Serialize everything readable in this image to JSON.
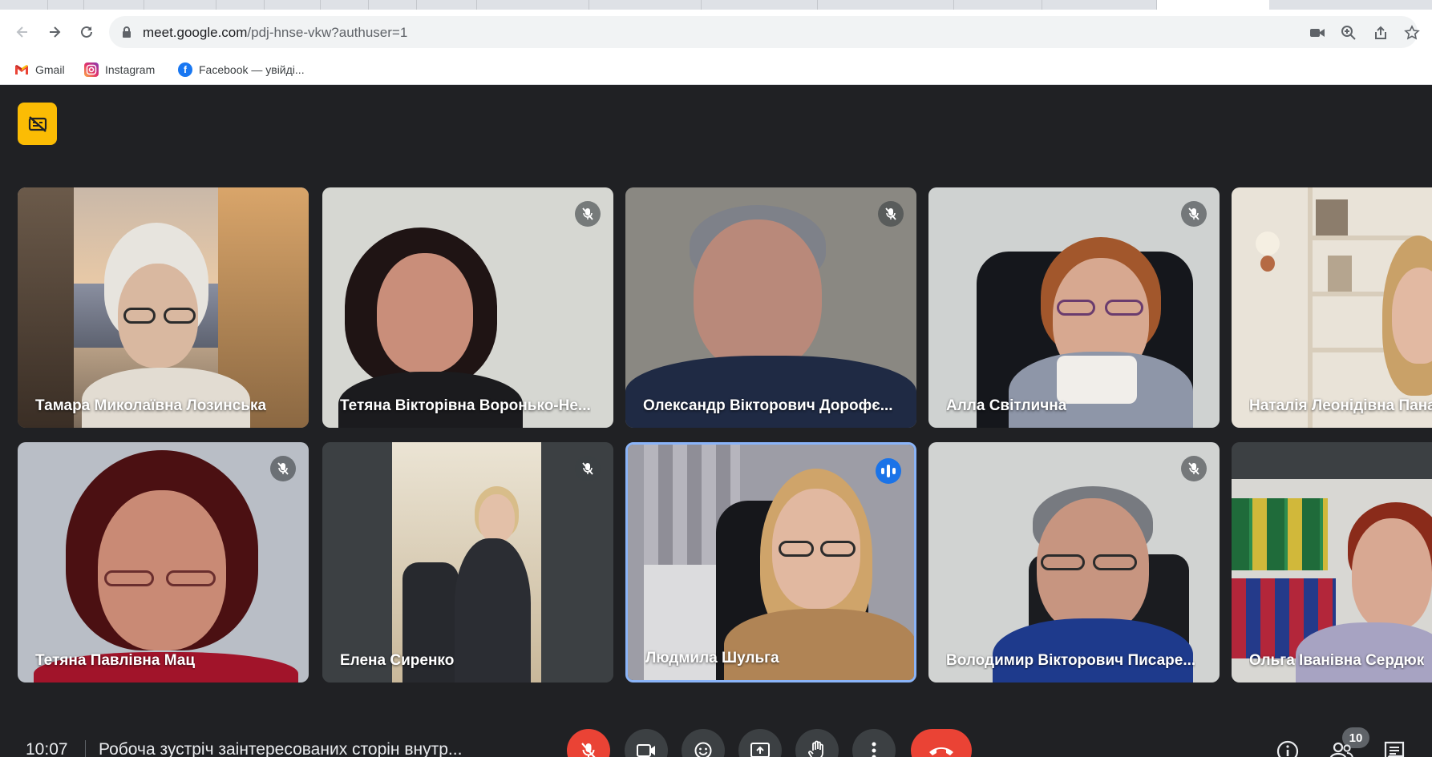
{
  "browser": {
    "url_host": "meet.google.com",
    "url_path": "/pdj-hnse-vkw?authuser=1",
    "bookmarks": [
      {
        "label": "Gmail",
        "icon": "gmail-icon"
      },
      {
        "label": "Instagram",
        "icon": "instagram-icon"
      },
      {
        "label": "Facebook — увійді...",
        "icon": "facebook-icon"
      }
    ]
  },
  "meet": {
    "captions_button": {
      "icon": "captions-off-icon",
      "accent": "#fbbc04"
    },
    "participants": [
      {
        "name": "Тамара Миколаївна Лозинська",
        "muted": false,
        "speaking": false
      },
      {
        "name": "Тетяна Вікторівна Воронько-Не...",
        "muted": true,
        "speaking": false
      },
      {
        "name": "Олександр Вікторович Дорофє...",
        "muted": true,
        "speaking": false
      },
      {
        "name": "Алла Світлична",
        "muted": true,
        "speaking": false
      },
      {
        "name": "Наталія Леонідівна Пана",
        "muted": false,
        "speaking": false
      },
      {
        "name": "Тетяна Павлівна Мац",
        "muted": true,
        "speaking": false
      },
      {
        "name": "Елена Сиренко",
        "muted": true,
        "speaking": false
      },
      {
        "name": "Людмила Шульга",
        "muted": false,
        "speaking": true
      },
      {
        "name": "Володимир Вікторович Писаре...",
        "muted": true,
        "speaking": false
      },
      {
        "name": "Ольга Іванівна Сердюк",
        "muted": false,
        "speaking": false
      }
    ],
    "bottom_bar": {
      "time": "10:07",
      "meeting_title": "Робоча зустріч заінтересованих сторін внутр...",
      "participant_count": "10",
      "controls": [
        "mic-off-icon",
        "camera-icon",
        "emoji-icon",
        "present-icon",
        "raise-hand-icon",
        "more-icon",
        "end-call-icon"
      ],
      "right_icons": [
        "info-icon",
        "people-icon",
        "chat-icon"
      ]
    },
    "colors": {
      "background": "#202124",
      "end_call": "#ea4335",
      "speaking": "#1a73e8",
      "active_border": "#8ab4f8"
    }
  }
}
